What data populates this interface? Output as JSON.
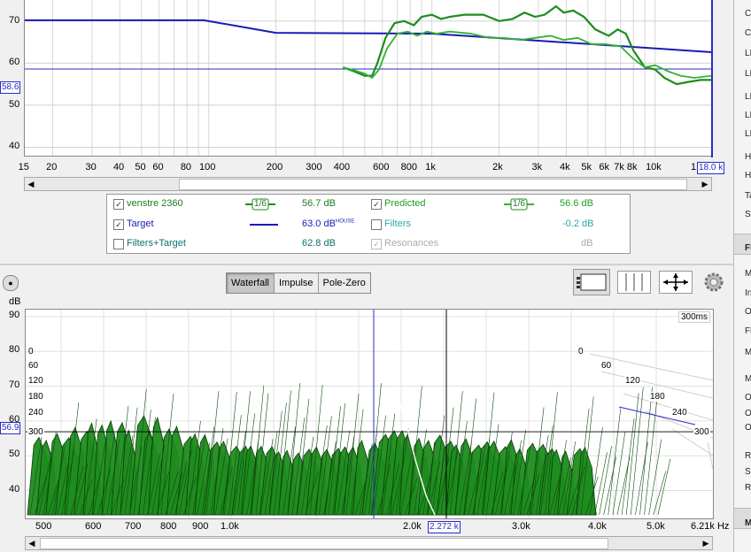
{
  "top_plot": {
    "y_ticks": [
      "70",
      "60",
      "50",
      "40"
    ],
    "x_ticks": [
      "15",
      "20",
      "30",
      "40",
      "50",
      "60",
      "80",
      "100",
      "200",
      "300",
      "400",
      "600",
      "800",
      "1k",
      "2k",
      "3k",
      "4k",
      "5k",
      "6k",
      "7k",
      "8k",
      "10k"
    ],
    "y_marker": "58.6",
    "x_marker": "18.0 k",
    "last_tick_partial": "1",
    "series_colors": {
      "measured": "#1e8c1e",
      "predicted": "#34b234",
      "target": "#1a1ab3"
    }
  },
  "legend": {
    "rows": [
      {
        "checked": true,
        "label": "venstre 2360",
        "smoothing": "1/6",
        "value": "56.7 dB"
      },
      {
        "checked": true,
        "label": "Target",
        "value": "63.0 dB",
        "superscript": "HOUSE"
      },
      {
        "checked": false,
        "label": "Filters+Target",
        "value": "62.8 dB"
      }
    ],
    "right_rows": [
      {
        "checked": true,
        "label": "Predicted",
        "smoothing": "1/6",
        "value": "56.6 dB"
      },
      {
        "checked": false,
        "label": "Filters",
        "value": "-0.2 dB"
      },
      {
        "checked": true,
        "label": "Resonances",
        "value": "dB"
      }
    ]
  },
  "tabs": [
    "Waterfall",
    "Impulse",
    "Pole-Zero"
  ],
  "active_tab": "Waterfall",
  "waterfall": {
    "unit": "dB",
    "y_ticks": [
      "90",
      "80",
      "70",
      "60",
      "50",
      "40"
    ],
    "x_ticks": [
      "500",
      "600",
      "700",
      "800",
      "900",
      "1.0k",
      "2.0k",
      "3.0k",
      "4.0k",
      "5.0k",
      "6.21k Hz"
    ],
    "x_cursor": "2.272 k",
    "y_marker": "56.9",
    "time_label": "300ms",
    "time_ticks_left": [
      "0",
      "60",
      "120",
      "180",
      "240",
      "300"
    ],
    "time_ticks_right": [
      "0",
      "60",
      "120",
      "180",
      "240",
      "300"
    ],
    "fill_color": "#1e8c1e"
  },
  "right_panel_letters": [
    "C",
    "C",
    "LI",
    "LI",
    "LI",
    "LI",
    "LI",
    "H",
    "H",
    "Ta",
    "S",
    "Fi",
    "M",
    "In",
    "O",
    "Fl",
    "M",
    "M",
    "O",
    "O",
    "O",
    "R",
    "S",
    "R",
    "M"
  ]
}
